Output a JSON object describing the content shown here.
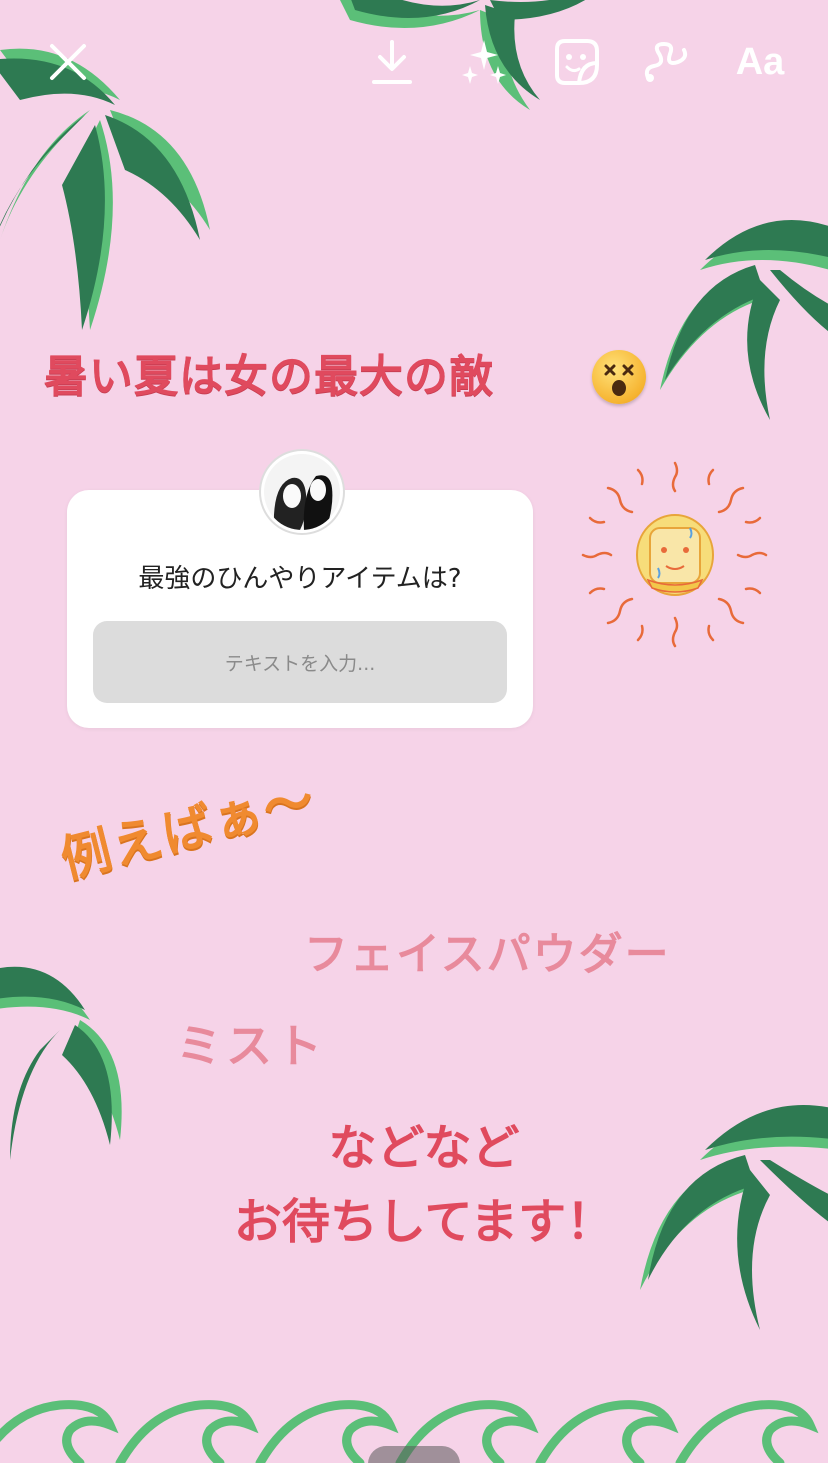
{
  "toolbar": {
    "close": "close-icon",
    "download": "download-icon",
    "effects": "sparkle-effects-icon",
    "sticker": "sticker-icon",
    "draw": "draw-icon",
    "text_label": "Aa"
  },
  "story": {
    "headline": "暑い夏は女の最大の敵",
    "headline_emoji": "dizzy-face-emoji",
    "question_sticker": {
      "question": "最強のひんやりアイテムは?",
      "placeholder": "テキストを入力..."
    },
    "tatoeba": "例えばぁ〜",
    "items": [
      "フェイスパウダー",
      "ミスト"
    ],
    "closing_line1": "などなど",
    "closing_line2": "お待ちしてます！"
  },
  "colors": {
    "background": "#f6d3e8",
    "palm_dark": "#2e7a52",
    "palm_light": "#5bbf78",
    "headline": "#e04a5e",
    "tatoeba": "#f08a30",
    "items": "#e88a9c"
  }
}
